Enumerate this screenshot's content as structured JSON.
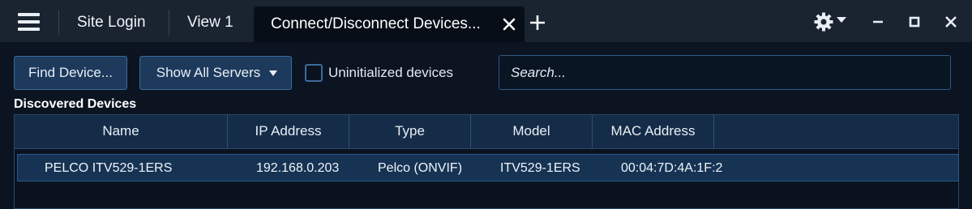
{
  "tabs": [
    {
      "label": "Site Login"
    },
    {
      "label": "View 1"
    },
    {
      "label": "Connect/Disconnect Devices..."
    }
  ],
  "toolbar": {
    "find_device_label": "Find Device...",
    "show_servers_label": "Show All Servers",
    "uninitialized_label": "Uninitialized devices",
    "search_placeholder": "Search..."
  },
  "section_title": "Discovered Devices",
  "table": {
    "columns": [
      "Name",
      "IP Address",
      "Type",
      "Model",
      "MAC Address"
    ],
    "rows": [
      {
        "name": "PELCO ITV529-1ERS",
        "ip": "192.168.0.203",
        "type": "Pelco (ONVIF)",
        "model": "ITV529-1ERS",
        "mac": "00:04:7D:4A:1F:2"
      }
    ]
  },
  "icons": [
    "menu-icon",
    "close-icon",
    "plus-icon",
    "gear-icon",
    "minimize-icon",
    "maximize-icon",
    "window-close-icon",
    "dropdown-arrow-icon"
  ],
  "colors": {
    "accent": "#1d3a5d",
    "border": "#3b6b9c",
    "selected_row": "#163354"
  }
}
